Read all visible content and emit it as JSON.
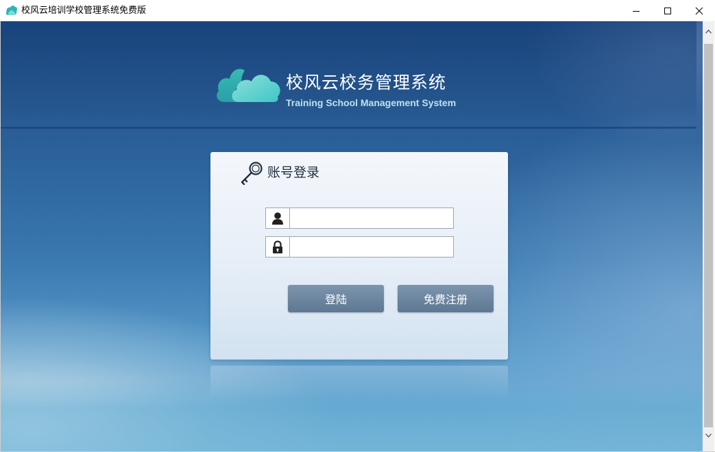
{
  "window": {
    "title": "校风云培训学校管理系统免费版",
    "app_icon": "cloud-logo-icon",
    "controls": {
      "minimize": "minimize-icon",
      "maximize": "maximize-icon",
      "close": "close-icon"
    }
  },
  "header": {
    "title": "校风云校务管理系统",
    "subtitle": "Training  School Management System",
    "logo_icon": "cloud-logo-icon"
  },
  "login": {
    "heading": "账号登录",
    "heading_icon": "key-icon",
    "username": {
      "value": "",
      "placeholder": "",
      "icon": "user-icon"
    },
    "password": {
      "value": "",
      "placeholder": "",
      "icon": "lock-icon"
    },
    "login_label": "登陆",
    "register_label": "免费注册"
  },
  "scrollbar": {
    "up_icon": "chevron-up-icon",
    "down_icon": "chevron-down-icon"
  },
  "colors": {
    "background_top": "#1f4d85",
    "background_bottom": "#7fb6d8",
    "logo_teal": "#3cc4c0",
    "button": "#6b86a1",
    "panel": "#eef3f9"
  }
}
